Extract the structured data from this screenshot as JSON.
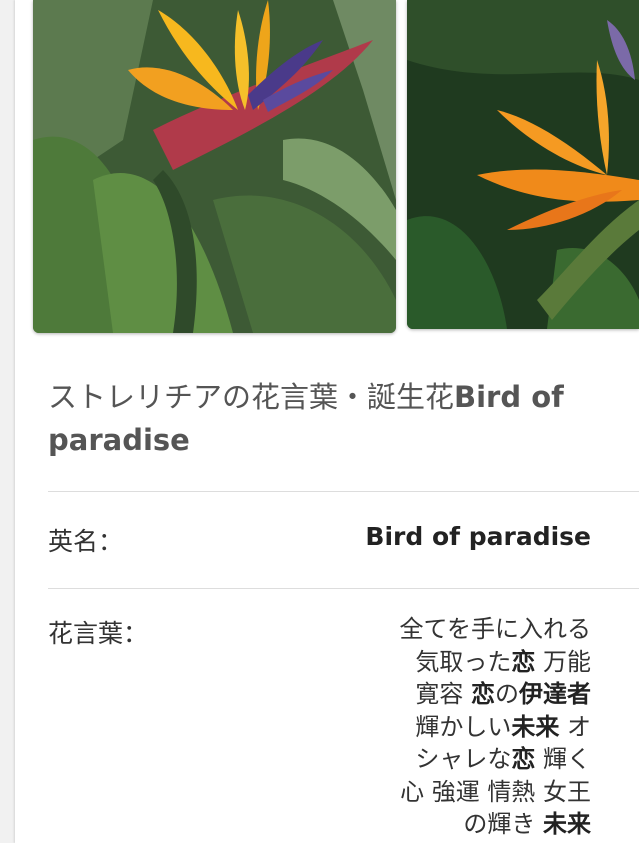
{
  "title": {
    "prefix": "ストレリチアの花言葉・誕生花",
    "bold": "Bird of paradise"
  },
  "rows": {
    "english_name": {
      "label": "英名：",
      "value": "Bird of paradise"
    },
    "flower_language": {
      "label": "花言葉：",
      "lines": [
        [
          "全てを手に入れる"
        ],
        [
          "気取った",
          "*恋",
          " 万能"
        ],
        [
          "寛容 ",
          "*恋",
          "の",
          "*伊達者"
        ],
        [
          "輝かしい",
          "*未来",
          " オ"
        ],
        [
          "シャレな",
          "*恋",
          " 輝く"
        ],
        [
          "心 強運 情熱 女王"
        ],
        [
          "の輝き ",
          "*未来"
        ]
      ]
    }
  },
  "images": {
    "first_alt": "",
    "second_alt": ""
  },
  "colors": {
    "card": "#ffffff",
    "page": "#f1f1f1",
    "text": "#333333",
    "divider": "#dddddd"
  }
}
